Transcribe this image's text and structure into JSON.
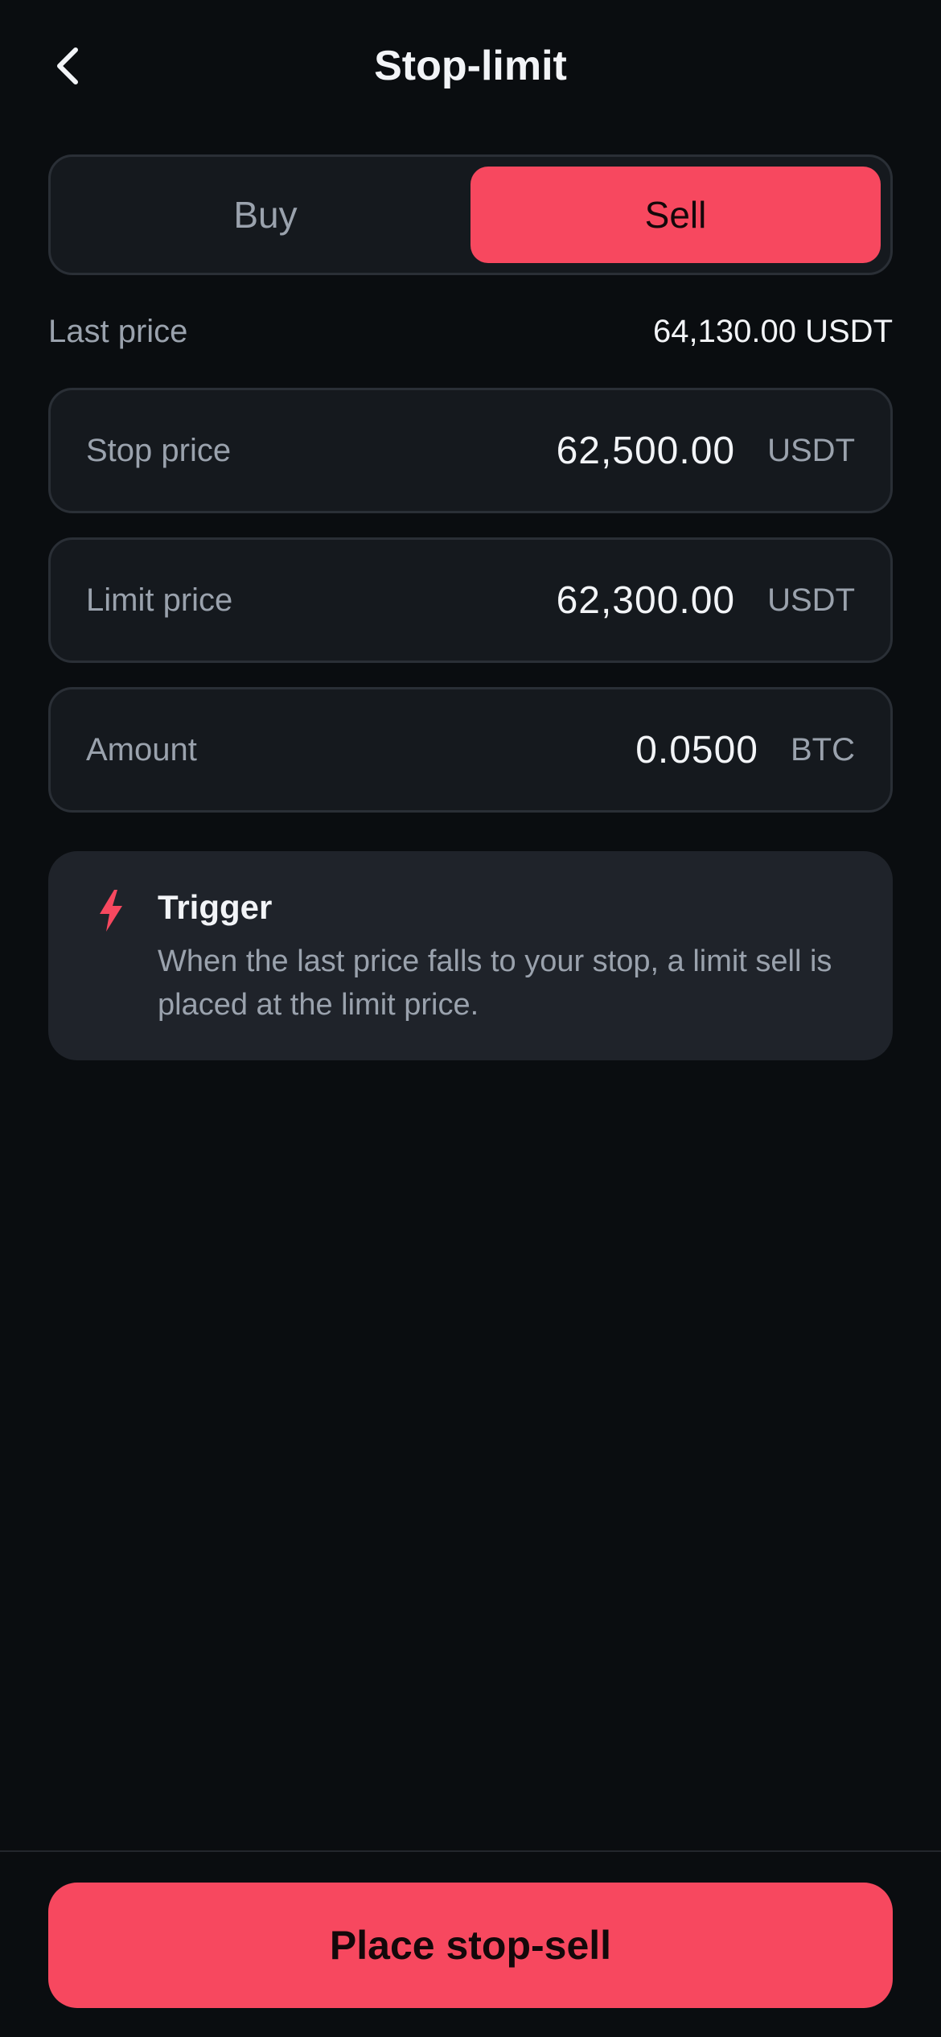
{
  "header": {
    "title": "Stop-limit",
    "back_icon": "chevron-left-icon"
  },
  "side_toggle": {
    "buy_label": "Buy",
    "sell_label": "Sell",
    "selected": "Sell"
  },
  "last_price": {
    "label": "Last price",
    "value": "64,130.00 USDT"
  },
  "fields": {
    "stop": {
      "label": "Stop price",
      "value": "62,500.00",
      "unit": "USDT"
    },
    "limit": {
      "label": "Limit price",
      "value": "62,300.00",
      "unit": "USDT"
    },
    "amount": {
      "label": "Amount",
      "value": "0.0500",
      "unit": "BTC"
    }
  },
  "trigger": {
    "icon": "lightning-bolt-icon",
    "title": "Trigger",
    "text": "When the last price falls to your stop, a limit sell is placed at the limit price."
  },
  "cta": {
    "label": "Place stop-sell"
  },
  "colors": {
    "background": "#0a0d10",
    "accent_sell": "#f7485f",
    "field_bg": "#15191e",
    "card_bg": "#1f232a",
    "muted_text": "#9aa2ad"
  }
}
